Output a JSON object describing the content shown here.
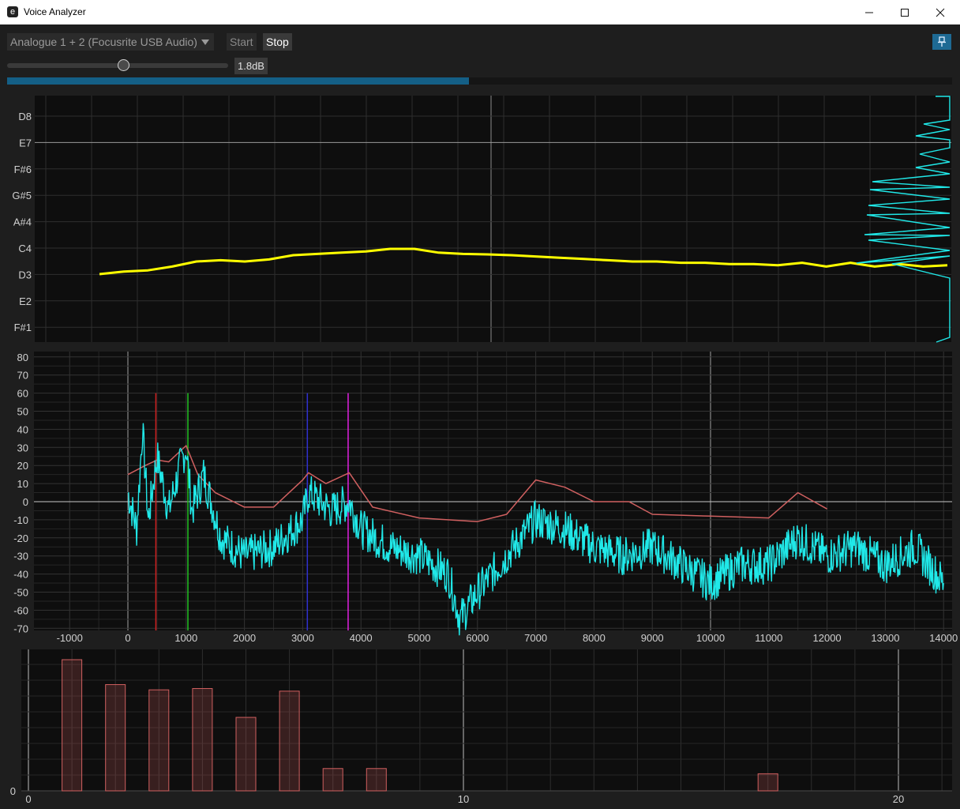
{
  "window": {
    "title": "Voice Analyzer",
    "app_icon": "e",
    "controls": [
      "minimize-icon",
      "maximize-icon",
      "close-icon"
    ]
  },
  "toolbar": {
    "device": "Analogue 1 + 2 (Focusrite USB Audio)",
    "start_label": "Start",
    "stop_label": "Stop",
    "pin_icon": "pin-icon",
    "gain_label": "1.8dB",
    "gain_slider_fraction": 0.53,
    "level_fraction": 0.489,
    "accent_color": "#145f86"
  },
  "chart_data": [
    {
      "type": "line",
      "name": "pitch",
      "y_tick_labels": [
        "D8",
        "E7",
        "F#6",
        "G#5",
        "A#4",
        "C4",
        "D3",
        "E2",
        "F#1"
      ],
      "series": [
        {
          "color": "#ffff00",
          "shape": [
            0.0,
            0.1,
            0.15,
            0.3,
            0.5,
            0.55,
            0.5,
            0.58,
            0.75,
            0.8,
            0.85,
            0.9,
            1.0,
            1.0,
            0.85,
            0.8,
            0.78,
            0.75,
            0.7,
            0.65,
            0.6,
            0.55,
            0.5,
            0.5,
            0.45,
            0.45,
            0.4,
            0.4,
            0.35,
            0.45,
            0.3,
            0.45,
            0.3,
            0.4,
            0.3,
            0.35
          ]
        }
      ],
      "grid": true
    },
    {
      "type": "line",
      "name": "spectrum",
      "xlim": [
        -1000,
        14000
      ],
      "ylim": [
        -70,
        80
      ],
      "x_ticks": [
        -1000,
        0,
        1000,
        2000,
        3000,
        4000,
        5000,
        6000,
        7000,
        8000,
        9000,
        10000,
        11000,
        12000,
        13000,
        14000
      ],
      "y_ticks": [
        80,
        70,
        60,
        50,
        40,
        30,
        20,
        10,
        0,
        -10,
        -20,
        -30,
        -40,
        -50,
        -60,
        -70
      ],
      "markers": [
        {
          "x": 480,
          "color": "#d02020"
        },
        {
          "x": 1030,
          "color": "#20c020"
        },
        {
          "x": 3080,
          "color": "#3030d0"
        },
        {
          "x": 3780,
          "color": "#e020e0"
        }
      ],
      "series": [
        {
          "color": "#d06060",
          "x": [
            0,
            300,
            500,
            700,
            1000,
            1200,
            1500,
            2000,
            2500,
            3000,
            3100,
            3400,
            3800,
            4200,
            5000,
            6000,
            6500,
            7000,
            7500,
            8000,
            8600,
            9000,
            10000,
            11000,
            11500,
            12000
          ],
          "y": [
            15,
            20,
            23,
            22,
            31,
            15,
            5,
            -3,
            -3,
            12,
            16,
            10,
            16,
            -3,
            -9,
            -11,
            -7,
            12,
            8,
            0,
            0,
            -7,
            -8,
            -9,
            5,
            -4
          ]
        },
        {
          "color": "#20e8e8",
          "x": [
            0,
            150,
            250,
            350,
            500,
            700,
            900,
            1000,
            1100,
            1300,
            1600,
            2000,
            2500,
            3000,
            3100,
            3500,
            3800,
            4000,
            4500,
            5000,
            5500,
            5700,
            6000,
            6500,
            7000,
            7500,
            8000,
            8500,
            9000,
            9500,
            10000,
            10500,
            11000,
            11500,
            12000,
            12500,
            13000,
            13500,
            14000
          ],
          "y": [
            5,
            -15,
            40,
            -10,
            25,
            -5,
            20,
            30,
            -5,
            15,
            -20,
            -30,
            -25,
            -10,
            5,
            -5,
            0,
            -15,
            -25,
            -30,
            -40,
            -65,
            -50,
            -30,
            -10,
            -15,
            -25,
            -30,
            -25,
            -35,
            -45,
            -35,
            -35,
            -20,
            -30,
            -25,
            -35,
            -25,
            -45
          ]
        }
      ],
      "grid": true
    },
    {
      "type": "bar",
      "name": "harmonics",
      "xlim": [
        0,
        21
      ],
      "x_ticks": [
        0,
        10,
        20
      ],
      "y_ticks": [
        0
      ],
      "bar_color": "#d06060",
      "x": [
        1,
        2,
        3,
        4,
        5,
        6,
        7,
        8,
        17
      ],
      "values": [
        100,
        81,
        77,
        78,
        56,
        76,
        17,
        17,
        13
      ],
      "grid": true
    }
  ]
}
